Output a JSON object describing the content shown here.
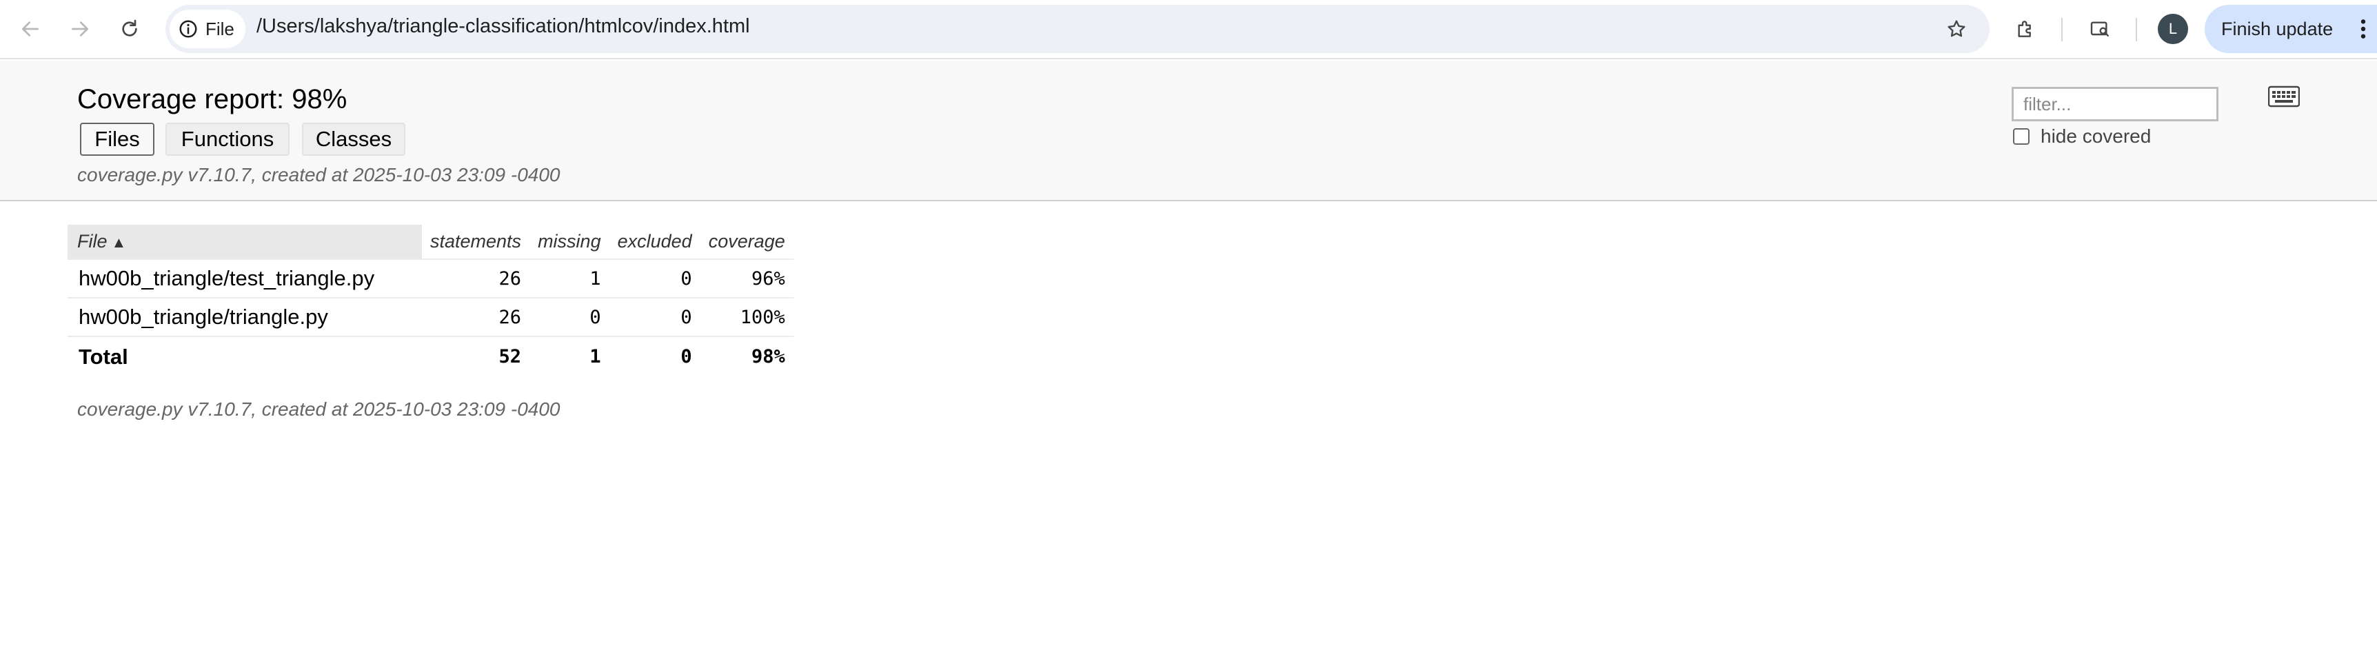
{
  "browser": {
    "chip_label": "File",
    "url": "/Users/lakshya/triangle-classification/htmlcov/index.html",
    "avatar_letter": "L",
    "finish_update_label": "Finish update",
    "icons": [
      "back-icon",
      "forward-icon",
      "reload-icon",
      "info-icon",
      "star-icon",
      "extensions-icon",
      "search-tabs-icon",
      "more-vert-icon"
    ]
  },
  "report": {
    "title": "Coverage report: 98%",
    "tabs": [
      {
        "label": "Files",
        "active": true
      },
      {
        "label": "Functions",
        "active": false
      },
      {
        "label": "Classes",
        "active": false
      }
    ],
    "created_text": "coverage.py v7.10.7, created at 2025-10-03 23:09 -0400",
    "filter_placeholder": "filter...",
    "hide_covered_label": "hide covered",
    "hide_covered_checked": false
  },
  "table": {
    "columns": [
      "File",
      "statements",
      "missing",
      "excluded",
      "coverage"
    ],
    "sort_indicator": "▲",
    "rows": [
      {
        "file": "hw00b_triangle/test_triangle.py",
        "statements": "26",
        "missing": "1",
        "excluded": "0",
        "coverage": "96%"
      },
      {
        "file": "hw00b_triangle/triangle.py",
        "statements": "26",
        "missing": "0",
        "excluded": "0",
        "coverage": "100%"
      }
    ],
    "total": {
      "label": "Total",
      "statements": "52",
      "missing": "1",
      "excluded": "0",
      "coverage": "98%"
    }
  },
  "footer": {
    "created_text": "coverage.py v7.10.7, created at 2025-10-03 23:09 -0400"
  },
  "colors": {
    "header_bg": "#f8f8f8",
    "omnibox_bg": "#edf0f7",
    "finish_update_bg": "#d3e3fd",
    "sorted_column_bg": "#e8e8e8",
    "muted_text": "#666666"
  }
}
